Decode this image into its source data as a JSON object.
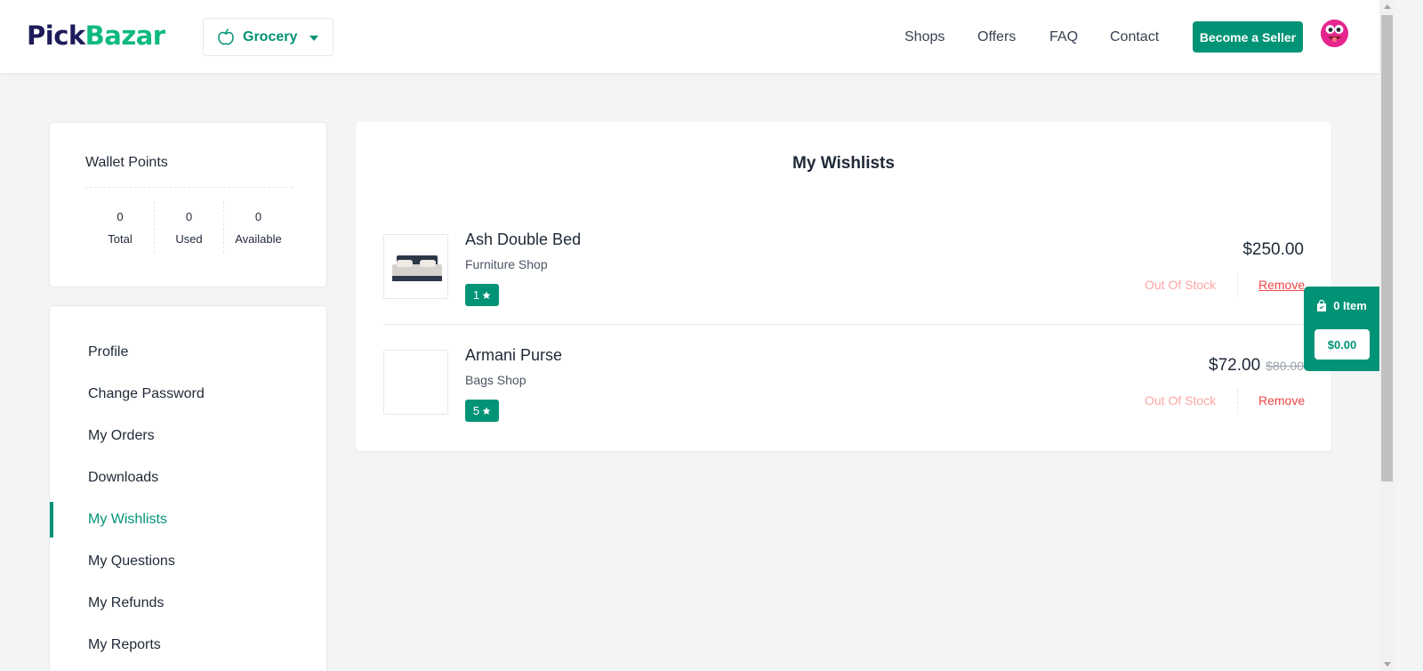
{
  "header": {
    "logo_part1": "Pick",
    "logo_part2": "Bazar",
    "shop_type": "Grocery",
    "nav": [
      "Shops",
      "Offers",
      "FAQ",
      "Contact"
    ],
    "seller_button": "Become a Seller"
  },
  "wallet": {
    "title": "Wallet Points",
    "stats": [
      {
        "value": "0",
        "label": "Total"
      },
      {
        "value": "0",
        "label": "Used"
      },
      {
        "value": "0",
        "label": "Available"
      }
    ]
  },
  "menu": {
    "items": [
      "Profile",
      "Change Password",
      "My Orders",
      "Downloads",
      "My Wishlists",
      "My Questions",
      "My Refunds",
      "My Reports"
    ],
    "active": "My Wishlists"
  },
  "wishlist": {
    "title": "My Wishlists",
    "items": [
      {
        "name": "Ash Double Bed",
        "shop": "Furniture Shop",
        "rating": "1",
        "price": "$250.00",
        "old_price": "",
        "stock": "Out Of Stock",
        "remove": "Remove"
      },
      {
        "name": "Armani Purse",
        "shop": "Bags Shop",
        "rating": "5",
        "price": "$72.00",
        "old_price": "$80.00",
        "stock": "Out Of Stock",
        "remove": "Remove"
      }
    ]
  },
  "cart": {
    "count_label": "0 Item",
    "total": "$0.00"
  },
  "colors": {
    "accent": "#019376",
    "danger": "#ef4444",
    "stock_muted": "#fca5a5"
  },
  "icons": [
    "apple-icon",
    "chevron-down-icon",
    "star-icon",
    "shopping-bag-icon",
    "avatar-icon"
  ]
}
